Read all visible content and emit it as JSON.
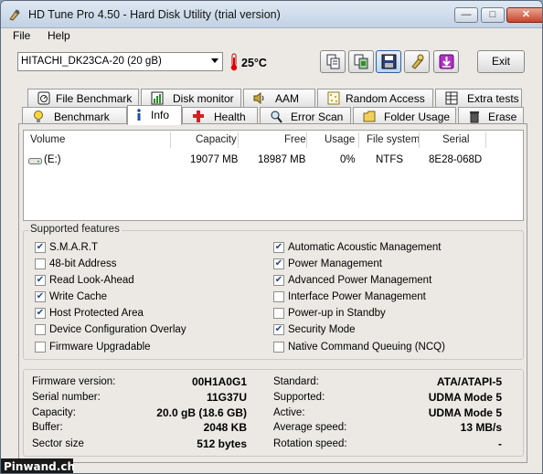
{
  "window": {
    "title": "HD Tune Pro 4.50 - Hard Disk Utility (trial version)",
    "minimize_icon": "minimize-icon",
    "maximize_icon": "maximize-icon",
    "close_icon": "close-icon"
  },
  "menu": {
    "file": "File",
    "help": "Help"
  },
  "toolbar": {
    "drive": "HITACHI_DK23CA-20 (20 gB)",
    "temperature": "25°C",
    "exit": "Exit"
  },
  "tabs_top": [
    {
      "label": "File Benchmark",
      "icon": "stopwatch-icon"
    },
    {
      "label": "Disk monitor",
      "icon": "bar-chart-icon"
    },
    {
      "label": "AAM",
      "icon": "speaker-icon"
    },
    {
      "label": "Random Access",
      "icon": "dots-grid-icon"
    },
    {
      "label": "Extra tests",
      "icon": "grid-icon"
    }
  ],
  "tabs_bottom": [
    {
      "label": "Benchmark",
      "icon": "lightbulb-icon"
    },
    {
      "label": "Info",
      "icon": "info-icon"
    },
    {
      "label": "Health",
      "icon": "health-cross-icon"
    },
    {
      "label": "Error Scan",
      "icon": "magnifier-icon"
    },
    {
      "label": "Folder Usage",
      "icon": "folder-icon"
    },
    {
      "label": "Erase",
      "icon": "trash-icon"
    }
  ],
  "volumes": {
    "headers": [
      "Volume",
      "Capacity",
      "Free",
      "Usage",
      "File system",
      "Serial"
    ],
    "rows": [
      {
        "volume": "(E:)",
        "capacity": "19077 MB",
        "free": "18987 MB",
        "usage": "0%",
        "file_system": "NTFS",
        "serial": "8E28-068D"
      }
    ]
  },
  "features": {
    "title": "Supported features",
    "left": [
      {
        "label": "S.M.A.R.T",
        "checked": true
      },
      {
        "label": "48-bit Address",
        "checked": false
      },
      {
        "label": "Read Look-Ahead",
        "checked": true
      },
      {
        "label": "Write Cache",
        "checked": true
      },
      {
        "label": "Host Protected Area",
        "checked": true
      },
      {
        "label": "Device Configuration Overlay",
        "checked": false
      },
      {
        "label": "Firmware Upgradable",
        "checked": false
      }
    ],
    "right": [
      {
        "label": "Automatic Acoustic Management",
        "checked": true
      },
      {
        "label": "Power Management",
        "checked": true
      },
      {
        "label": "Advanced Power Management",
        "checked": true
      },
      {
        "label": "Interface Power Management",
        "checked": false
      },
      {
        "label": "Power-up in Standby",
        "checked": false
      },
      {
        "label": "Security Mode",
        "checked": true
      },
      {
        "label": "Native Command Queuing (NCQ)",
        "checked": false
      }
    ]
  },
  "info": {
    "left": [
      {
        "label": "Firmware version:",
        "value": "00H1A0G1"
      },
      {
        "label": "Serial number:",
        "value": "11G37U"
      },
      {
        "label": "Capacity:",
        "value": "20.0 gB (18.6 GB)"
      },
      {
        "label": "Buffer:",
        "value": "2048 KB"
      },
      {
        "label": "Sector size",
        "value": "512 bytes"
      }
    ],
    "right": [
      {
        "label": "Standard:",
        "value": "ATA/ATAPI-5"
      },
      {
        "label": "Supported:",
        "value": "UDMA Mode 5"
      },
      {
        "label": "Active:",
        "value": "UDMA Mode 5"
      },
      {
        "label": "Average speed:",
        "value": "13 MB/s"
      },
      {
        "label": "Rotation speed:",
        "value": "-"
      }
    ]
  },
  "watermark": "Pinwand.ch"
}
